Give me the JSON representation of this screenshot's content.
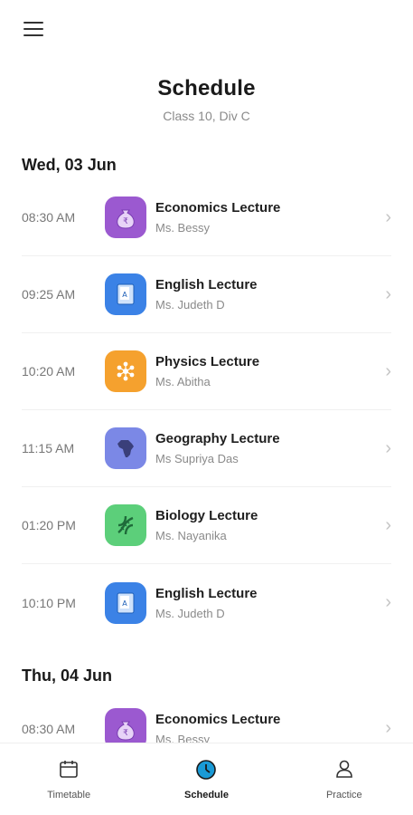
{
  "header": {
    "title": "Schedule",
    "subtitle": "Class 10, Div C"
  },
  "days": [
    {
      "label": "Wed, 03 Jun",
      "lectures": [
        {
          "time": "08:30 AM",
          "name": "Economics Lecture",
          "teacher": "Ms. Bessy",
          "icon": "rupee-bag-icon",
          "color": "#9b59d0"
        },
        {
          "time": "09:25 AM",
          "name": "English Lecture",
          "teacher": "Ms. Judeth D",
          "icon": "book-icon",
          "color": "#3b82e6"
        },
        {
          "time": "10:20 AM",
          "name": "Physics Lecture",
          "teacher": "Ms. Abitha",
          "icon": "atom-icon",
          "color": "#f5a12e"
        },
        {
          "time": "11:15 AM",
          "name": "Geography Lecture",
          "teacher": "Ms Supriya Das",
          "icon": "africa-map-icon",
          "color": "#7b88e6"
        },
        {
          "time": "01:20 PM",
          "name": "Biology Lecture",
          "teacher": "Ms. Nayanika",
          "icon": "dna-icon",
          "color": "#5ccf7a"
        },
        {
          "time": "10:10 PM",
          "name": "English Lecture",
          "teacher": "Ms. Judeth D",
          "icon": "book-icon",
          "color": "#3b82e6"
        }
      ]
    },
    {
      "label": "Thu, 04 Jun",
      "lectures": [
        {
          "time": "08:30 AM",
          "name": "Economics Lecture",
          "teacher": "Ms. Bessy",
          "icon": "rupee-bag-icon",
          "color": "#9b59d0"
        }
      ]
    }
  ],
  "nav": {
    "items": [
      {
        "label": "Timetable",
        "icon": "calendar-icon"
      },
      {
        "label": "Schedule",
        "icon": "clock-icon",
        "active": true
      },
      {
        "label": "Practice",
        "icon": "person-icon"
      }
    ],
    "accent": "#1a9ad6"
  }
}
